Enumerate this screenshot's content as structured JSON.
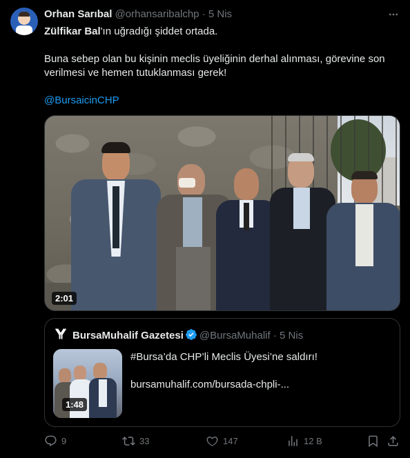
{
  "tweet": {
    "author_name": "Orhan Sarıbal",
    "author_handle": "@orhansaribalchp",
    "separator": "·",
    "time": "5 Nis",
    "text_bold": "Zülfikar Bal",
    "text_line1_rest": "'ın uğradığı şiddet ortada.",
    "text_para2": "Buna sebep olan bu kişinin meclis üyeliğinin derhal alınması, görevine son verilmesi ve hemen tutuklanması gerek!",
    "mention": "@BursaicinCHP",
    "video_duration": "2:01"
  },
  "quote": {
    "avatar_letter": "𝕐",
    "name": "BursaMuhalif Gazetesi",
    "handle": "@BursaMuhalif",
    "separator": "·",
    "time": "5 Nis",
    "headline": "#Bursa’da CHP’li Meclis Üyesi’ne saldırı!",
    "link": "bursamuhalif.com/bursada-chpli-...",
    "video_duration": "1:48"
  },
  "actions": {
    "replies": "9",
    "retweets": "33",
    "likes": "147",
    "views": "12 B"
  },
  "colors": {
    "background": "#000000",
    "text": "#e7e9ea",
    "muted": "#71767b",
    "link": "#1d9bf0",
    "border": "#2f3336"
  }
}
